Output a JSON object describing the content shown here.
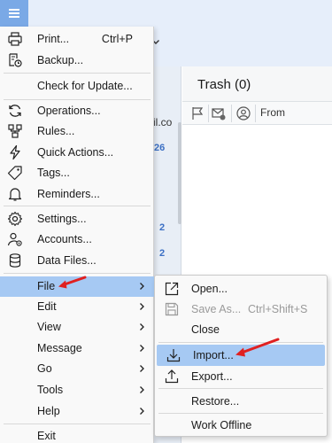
{
  "background": {
    "trash_folder": {
      "name": "Trash",
      "count": "(0)"
    },
    "column_from": "From",
    "account_fragment": "il.co",
    "counts": [
      "26",
      "2",
      "2"
    ]
  },
  "main_menu": {
    "print": {
      "label": "Print...",
      "shortcut": "Ctrl+P"
    },
    "backup": "Backup...",
    "check_update": "Check for Update...",
    "operations": "Operations...",
    "rules": "Rules...",
    "quick_actions": "Quick Actions...",
    "tags": "Tags...",
    "reminders": "Reminders...",
    "settings": "Settings...",
    "accounts": "Accounts...",
    "data_files": "Data Files...",
    "file": "File",
    "edit": "Edit",
    "view": "View",
    "message": "Message",
    "go": "Go",
    "tools": "Tools",
    "help": "Help",
    "exit": "Exit"
  },
  "file_submenu": {
    "open": "Open...",
    "save_as": {
      "label": "Save As...",
      "shortcut": "Ctrl+Shift+S"
    },
    "close": "Close",
    "import": "Import...",
    "export": "Export...",
    "restore": "Restore...",
    "work_offline": "Work Offline"
  },
  "colors": {
    "highlight": "#a6c9f3",
    "accent": "#7aa9e6",
    "annotation_arrow": "#e02020",
    "count_blue": "#3b6fc4"
  }
}
